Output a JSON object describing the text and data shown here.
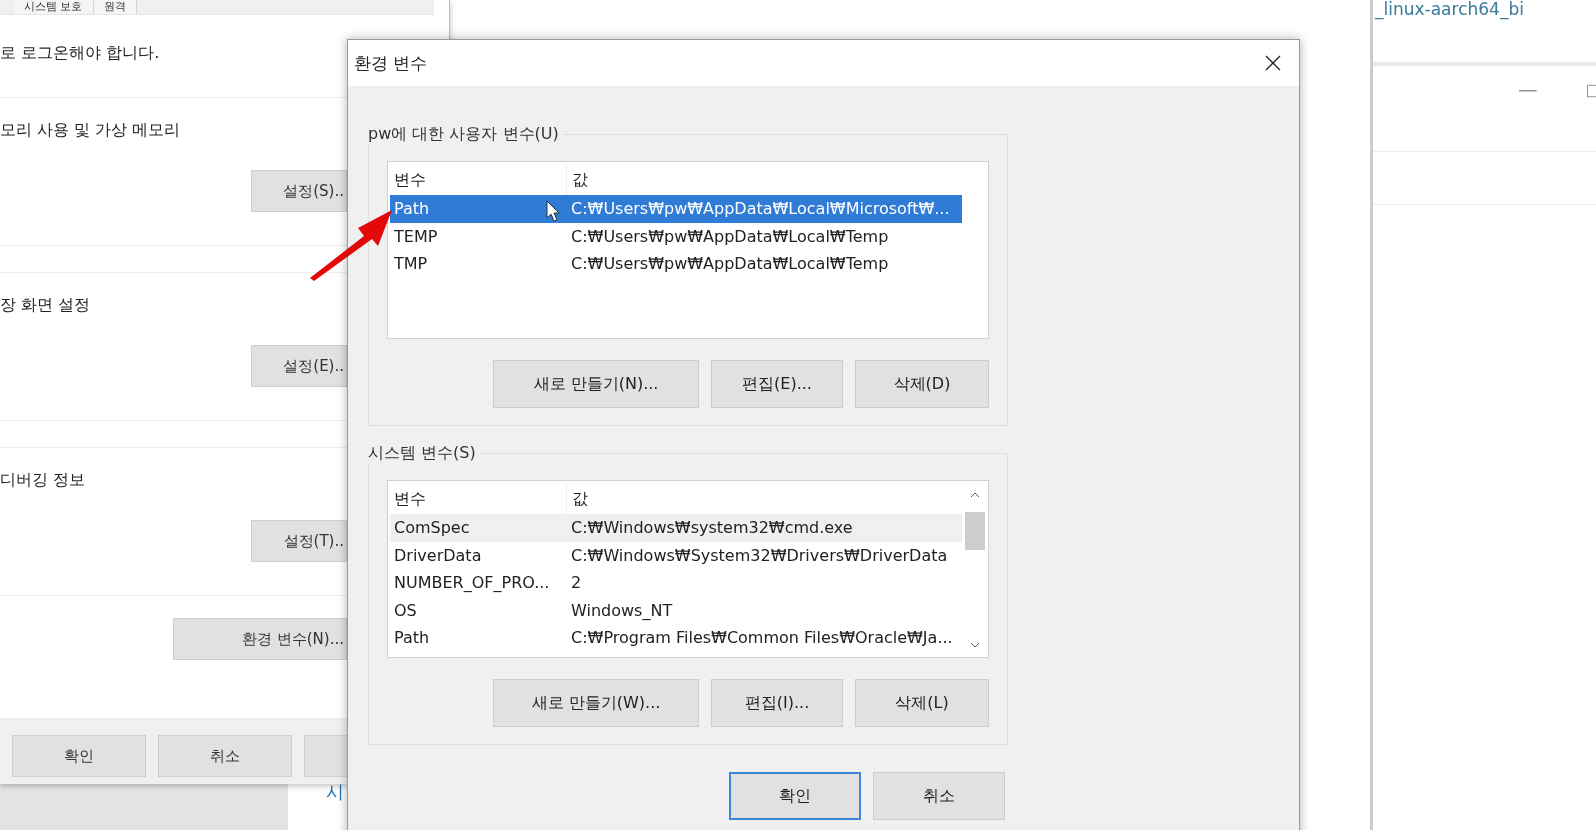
{
  "background_window": {
    "tabs": [
      "시스템 보호",
      "원격"
    ],
    "sections": [
      {
        "text": "로 로그온해야 합니다."
      },
      {
        "text": "모리 사용 및 가상 메모리",
        "button": "설정(S).."
      },
      {
        "text": "장 화면 설정",
        "button": "설정(E).."
      },
      {
        "text": "디버깅 정보",
        "button": "설정(T).."
      }
    ],
    "env_button": "환경 변수(N)...",
    "buttons": [
      "확인",
      "취소"
    ],
    "cut_button": true,
    "link": "시"
  },
  "dialog": {
    "title": "환경 변수",
    "user_vars": {
      "label": "pw에 대한 사용자 변수(U)",
      "columns": [
        "변수",
        "값"
      ],
      "rows": [
        {
          "name": "Path",
          "value": "C:₩Users₩pw₩AppData₩Local₩Microsoft₩...",
          "selected": true
        },
        {
          "name": "TEMP",
          "value": "C:₩Users₩pw₩AppData₩Local₩Temp",
          "selected": false
        },
        {
          "name": "TMP",
          "value": "C:₩Users₩pw₩AppData₩Local₩Temp",
          "selected": false
        }
      ],
      "buttons": [
        "새로 만들기(N)...",
        "편집(E)...",
        "삭제(D)"
      ]
    },
    "system_vars": {
      "label": "시스템 변수(S)",
      "columns": [
        "변수",
        "값"
      ],
      "rows": [
        {
          "name": "ComSpec",
          "value": "C:₩Windows₩system32₩cmd.exe",
          "hovered": true
        },
        {
          "name": "DriverData",
          "value": "C:₩Windows₩System32₩Drivers₩DriverData",
          "hovered": false
        },
        {
          "name": "NUMBER_OF_PRO...",
          "value": "2",
          "hovered": false
        },
        {
          "name": "OS",
          "value": "Windows_NT",
          "hovered": false
        },
        {
          "name": "Path",
          "value": "C:₩Program Files₩Common Files₩Oracle₩Ja...",
          "hovered": false
        }
      ],
      "buttons": [
        "새로 만들기(W)...",
        "편집(I)...",
        "삭제(L)"
      ]
    },
    "buttons": [
      {
        "label": "확인",
        "focused": true
      },
      {
        "label": "취소",
        "focused": false
      }
    ]
  },
  "right_window": {
    "text": "_linux-aarch64_bi"
  }
}
